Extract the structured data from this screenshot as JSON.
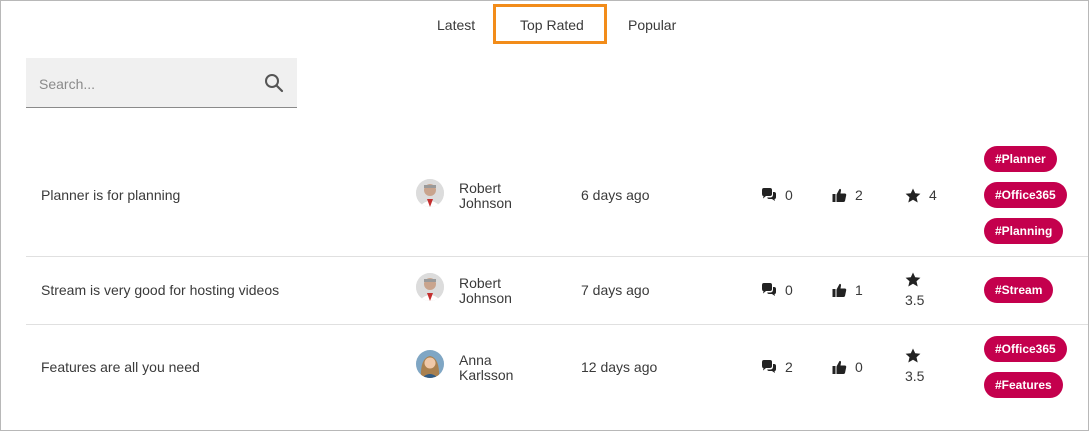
{
  "tabs": [
    {
      "label": "Latest",
      "active": false
    },
    {
      "label": "Top Rated",
      "active": true
    },
    {
      "label": "Popular",
      "active": false
    }
  ],
  "search": {
    "placeholder": "Search...",
    "value": ""
  },
  "accent_color": "#c4004d",
  "highlight_color": "#f28c1a",
  "posts": [
    {
      "title": "Planner is for planning",
      "author_first": "Robert",
      "author_last": "Johnson",
      "date": "6 days ago",
      "comments": "0",
      "likes": "2",
      "rating": "4",
      "tags": [
        "#Planner",
        "#Office365",
        "#Planning"
      ]
    },
    {
      "title": "Stream is very good for hosting videos",
      "author_first": "Robert",
      "author_last": "Johnson",
      "date": "7 days ago",
      "comments": "0",
      "likes": "1",
      "rating": "3.5",
      "tags": [
        "#Stream"
      ]
    },
    {
      "title": "Features are all you need",
      "author_first": "Anna",
      "author_last": "Karlsson",
      "date": "12 days ago",
      "comments": "2",
      "likes": "0",
      "rating": "3.5",
      "tags": [
        "#Office365",
        "#Features"
      ]
    }
  ]
}
